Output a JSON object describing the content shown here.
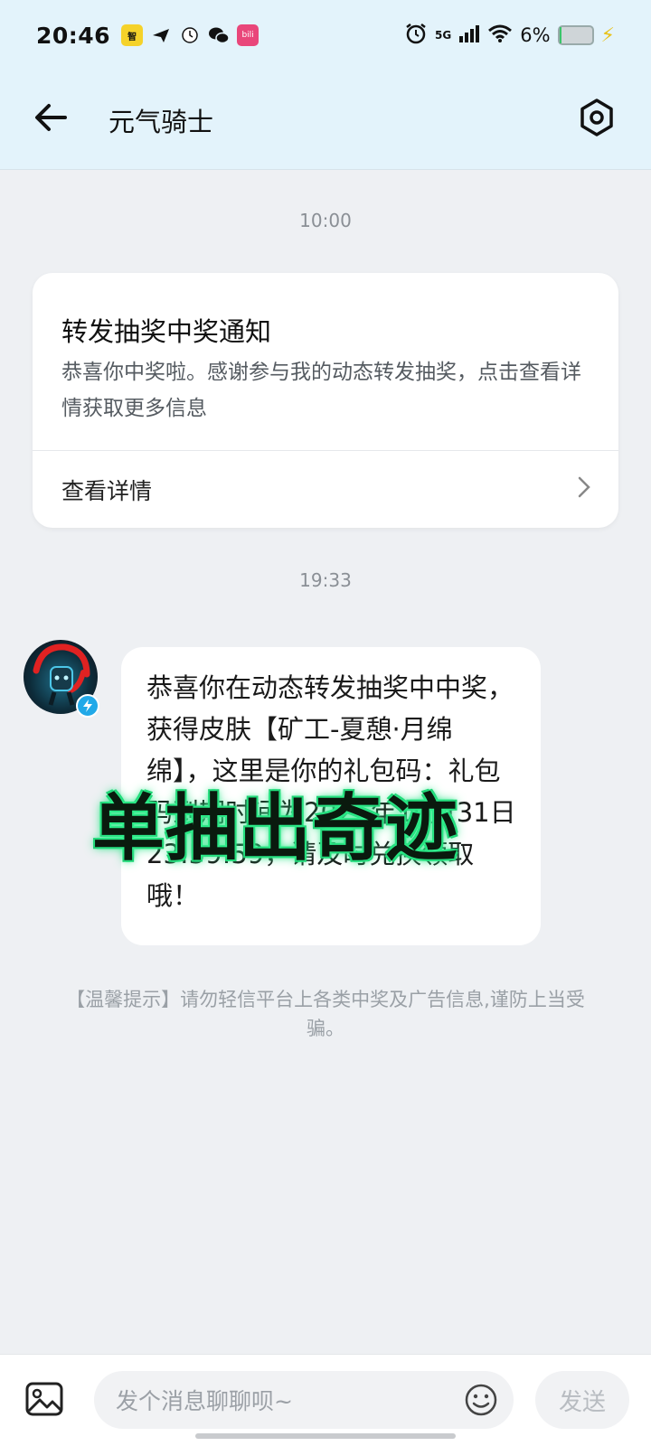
{
  "status_bar": {
    "time": "20:46",
    "network": "5G",
    "battery": "6%",
    "app_icons": [
      "yellow-app-icon",
      "paper-plane-icon",
      "clock-app-icon",
      "wechat-icon",
      "bilibili-icon"
    ],
    "yellow_app_label": "智",
    "pink_app_label": "bili"
  },
  "header": {
    "title": "元气骑士"
  },
  "messages": {
    "time_1": "10:00",
    "card": {
      "title": "转发抽奖中奖通知",
      "description": "恭喜你中奖啦。感谢参与我的动态转发抽奖，点击查看详情获取更多信息",
      "link_label": "查看详情"
    },
    "time_2": "19:33",
    "bubble_text": "恭喜你在动态转发抽奖中中奖，获得皮肤【矿工-夏憩·月绵绵】，这里是你的礼包码：礼包码到期时间为2025年10月31日23:59:59，请及时兑换领取哦！",
    "overlay_text": "单抽出奇迹",
    "warning": "【温馨提示】请勿轻信平台上各类中奖及广告信息,谨防上当受骗。"
  },
  "input_bar": {
    "placeholder": "发个消息聊聊呗~",
    "send_label": "发送"
  },
  "colors": {
    "header_bg": "#e3f3fb",
    "page_bg": "#eef0f3",
    "overlay_glow": "#23e07f",
    "verify_badge": "#21a9e8"
  }
}
